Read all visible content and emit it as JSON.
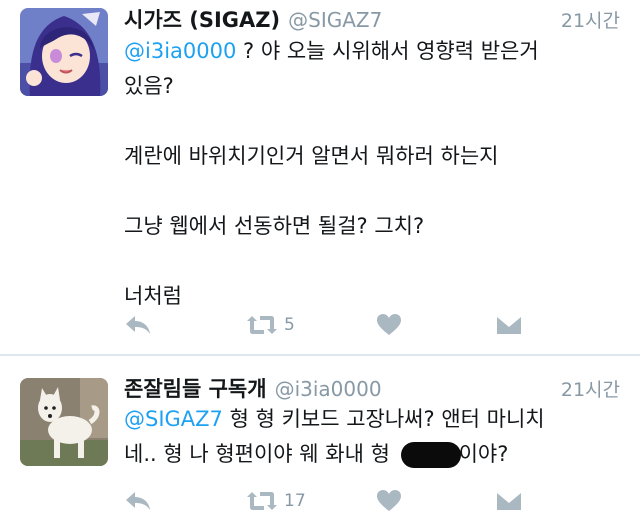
{
  "tweets": [
    {
      "name": "시가즈 (SIGAZ)",
      "handle": "@SIGAZ7",
      "time": "21시간",
      "mention": "@i3ia0000",
      "text_line1_rest": " ? 야 오늘 시위해서 영향력 받은거",
      "text_line2": "있음?",
      "text_para2": "계란에 바위치기인거 알면서 뭐하러 하는지",
      "text_para3": "그냥 웹에서 선동하면 될걸? 그치?",
      "text_para4": "너처럼",
      "retweet_count": "5",
      "avatar_icon": "anime-character-avatar"
    },
    {
      "name": "존잘림들 구독개",
      "handle": "@i3ia0000",
      "time": "21시간",
      "mention": "@SIGAZ7",
      "text_line1_rest": " 형 형 키보드 고장나써? 앤터 마니치",
      "text_line2_before": "네.. 형 나 형편이야 웨 화내 형 ",
      "text_line2_after": "이야?",
      "retweet_count": "17",
      "avatar_icon": "white-dog-avatar"
    }
  ],
  "colors": {
    "link": "#1da1f2",
    "meta": "#8899a6",
    "icon": "#aab8c2",
    "text": "#14171a"
  }
}
